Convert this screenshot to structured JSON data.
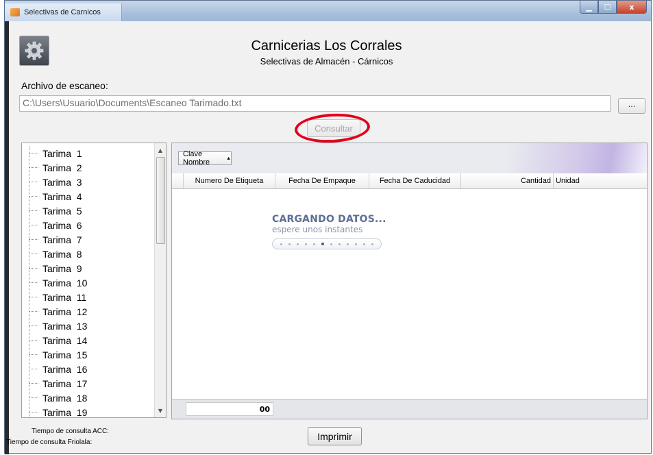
{
  "window": {
    "title": "Selectivas de Carnicos",
    "controls": {
      "minimize": "▁",
      "maximize": "☐",
      "close": "x"
    }
  },
  "header": {
    "title": "Carnicerias Los Corrales",
    "subtitle": "Selectivas de Almacén - Cárnicos",
    "icon": "gear-icon"
  },
  "file": {
    "label": "Archivo de escaneo:",
    "path": "C:\\Users\\Usuario\\Documents\\Escaneo Tarimado.txt",
    "browse_label": "...",
    "consultar_label": "Consultar"
  },
  "annotation": {
    "highlight_color": "#e3001b"
  },
  "tree": {
    "items": [
      "Tarima  1",
      "Tarima  2",
      "Tarima  3",
      "Tarima  4",
      "Tarima  5",
      "Tarima  6",
      "Tarima  7",
      "Tarima  8",
      "Tarima  9",
      "Tarima  10",
      "Tarima  11",
      "Tarima  12",
      "Tarima  13",
      "Tarima  14",
      "Tarima  15",
      "Tarima  16",
      "Tarima  17",
      "Tarima  18",
      "Tarima  19"
    ]
  },
  "grid": {
    "group_by": "Clave Nombre",
    "columns": [
      "Numero De Etiqueta",
      "Fecha De Empaque",
      "Fecha De Caducidad",
      "Cantidad",
      "Unidad"
    ],
    "loading_title": "CARGANDO DATOS...",
    "loading_subtitle": "espere unos instantes",
    "loading_progress_dot": 6,
    "footer_total": "00"
  },
  "footer": {
    "acc_label": "Tiempo de consulta ACC:",
    "friolala_label": "Tiempo de consulta Friolala:",
    "print_label": "Imprimir"
  }
}
